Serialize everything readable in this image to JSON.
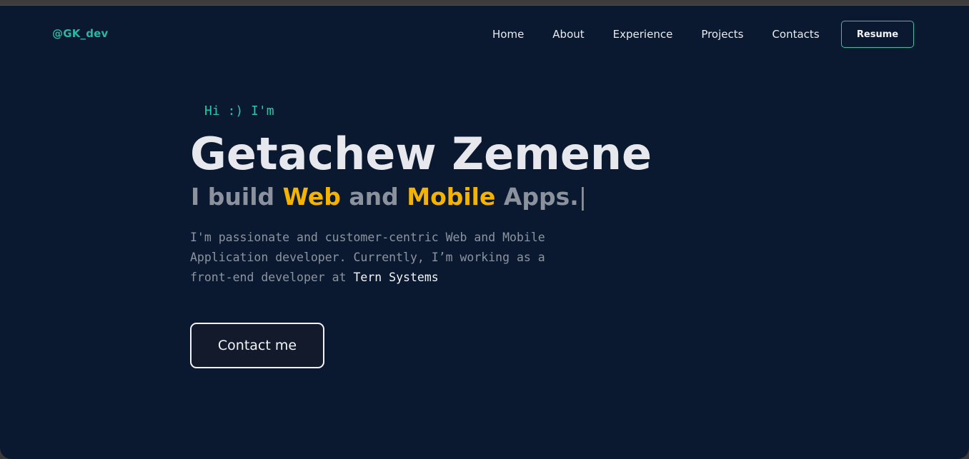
{
  "header": {
    "logo": "@GK_dev",
    "nav": [
      "Home",
      "About",
      "Experience",
      "Projects",
      "Contacts"
    ],
    "resume_label": "Resume"
  },
  "hero": {
    "greeting": "Hi :) I'm",
    "name": "Getachew Zemene",
    "tagline": {
      "part1": "I build ",
      "highlight1": "Web",
      "part2": " and ",
      "highlight2": "Mobile",
      "part3": " Apps.",
      "cursor": "|"
    },
    "bio": {
      "text": "I'm passionate and customer-centric Web and Mobile Application developer. Currently, I’m working as a front-end developer at ",
      "company": "Tern Systems"
    },
    "contact_label": "Contact me"
  },
  "colors": {
    "background": "#0b1930",
    "accent": "#2bc4b0",
    "highlight": "#f5b300"
  }
}
